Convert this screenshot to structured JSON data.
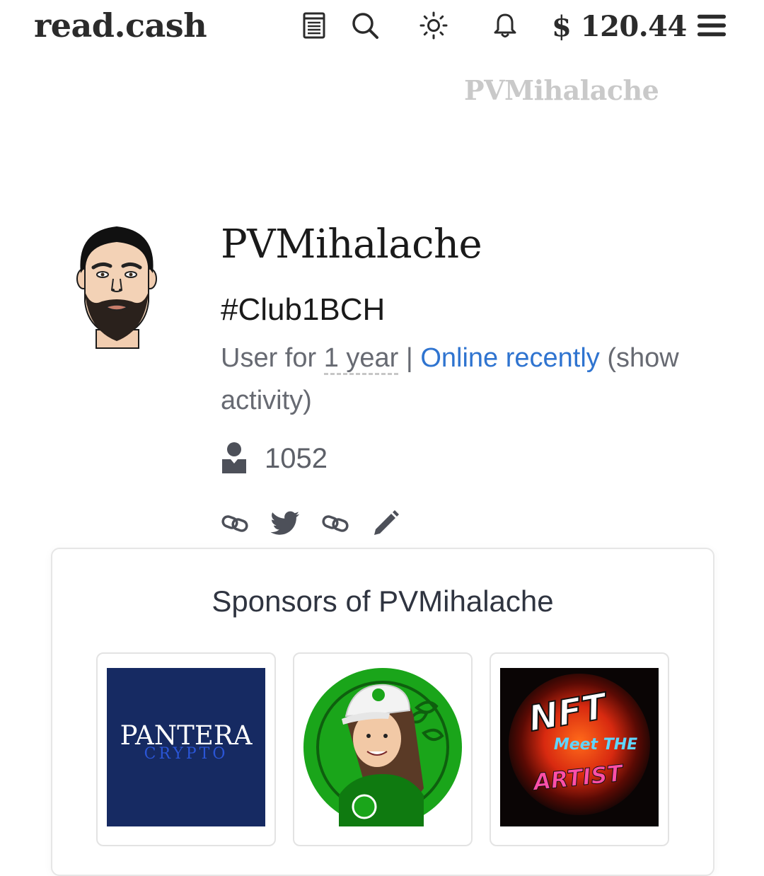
{
  "header": {
    "logo": "read.cash",
    "balance": "$ 120.44",
    "icons": [
      "article-icon",
      "search-icon",
      "theme-sun-icon",
      "bell-icon",
      "hamburger-menu-icon"
    ]
  },
  "profile": {
    "watermark": "PVMihalache",
    "name": "PVMihalache",
    "tagline": "#Club1BCH",
    "user_for_label": "User for",
    "user_for_value": "1 year",
    "separator": "|",
    "online_status": "Online recently",
    "activity_link": "(show activity)",
    "followers_count": "1052",
    "social_icons": [
      "link-icon",
      "twitter-icon",
      "link-icon",
      "edit-pencil-icon"
    ]
  },
  "sponsors": {
    "title": "Sponsors of PVMihalache",
    "items": [
      {
        "name": "Pantera Crypto",
        "logo_main": "PANTERA",
        "logo_sub": "CRYPTO"
      },
      {
        "name": "BCH avatar"
      },
      {
        "name": "NFT Meet The Artist",
        "logo_line1": "NFT",
        "logo_line2": "Meet THE",
        "logo_line3": "ARTIST"
      }
    ]
  },
  "colors": {
    "link_blue": "#2f74d0",
    "muted_text": "#676a72",
    "watermark": "#c9c9c9",
    "pantera_navy": "#162a62",
    "bch_green": "#1aa51a"
  }
}
